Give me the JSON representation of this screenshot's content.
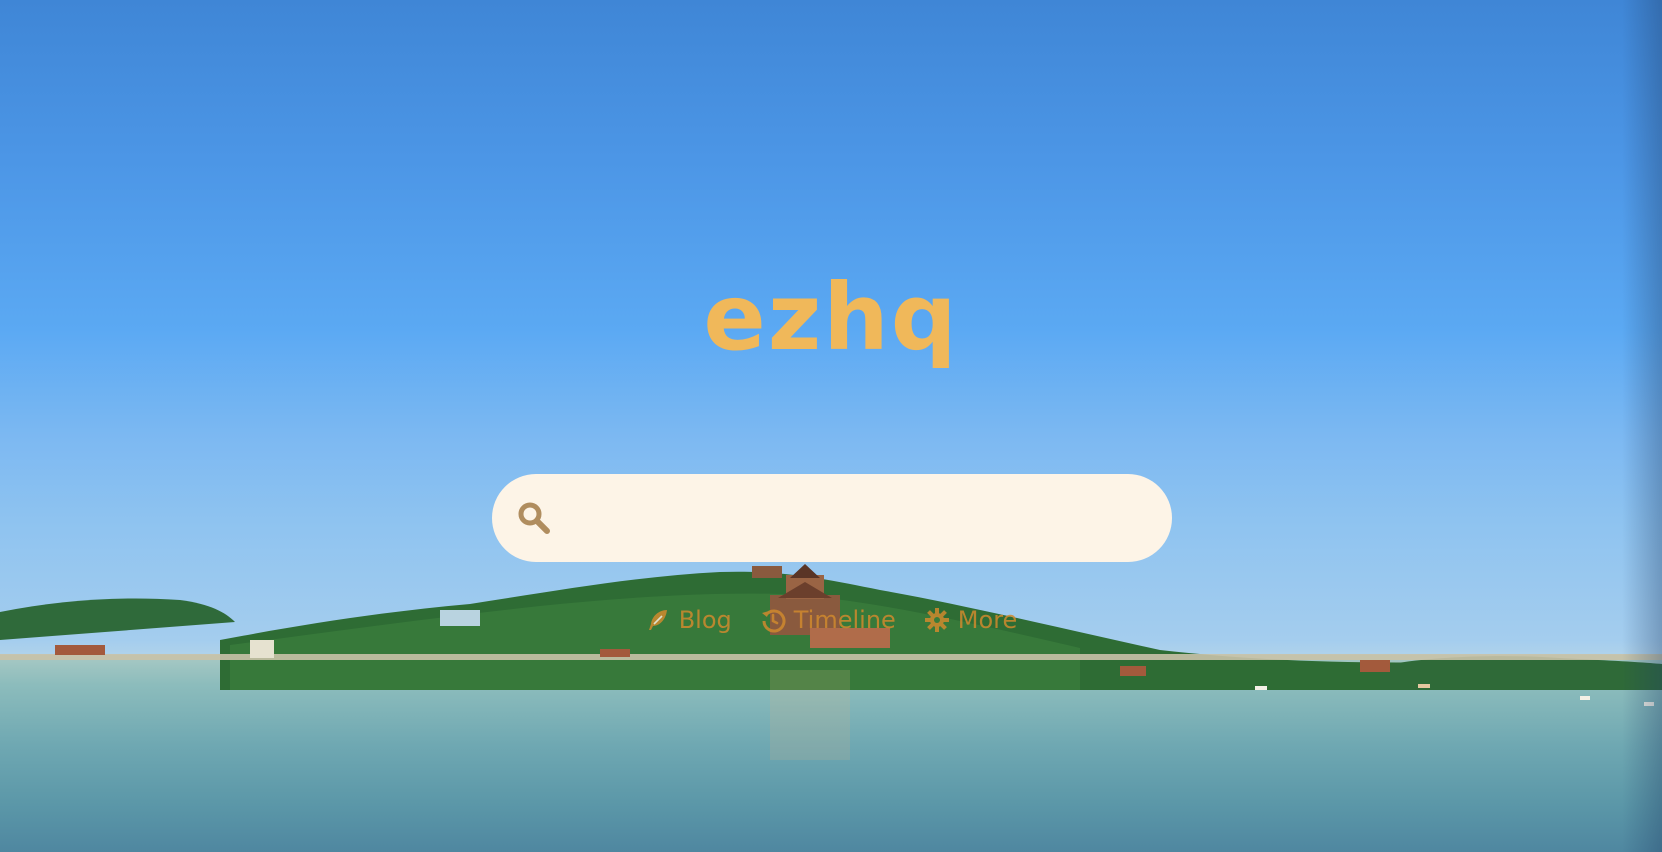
{
  "site": {
    "title": "ezhq"
  },
  "search": {
    "placeholder": "",
    "value": ""
  },
  "nav": {
    "items": [
      {
        "label": "Blog",
        "icon": "feather-icon"
      },
      {
        "label": "Timeline",
        "icon": "history-icon"
      },
      {
        "label": "More",
        "icon": "gear-icon"
      }
    ]
  },
  "colors": {
    "accent": "#f0b85a",
    "search_bg": "#fdf4e7",
    "search_icon": "#b08d5f",
    "nav_text": "#d08a2e"
  }
}
